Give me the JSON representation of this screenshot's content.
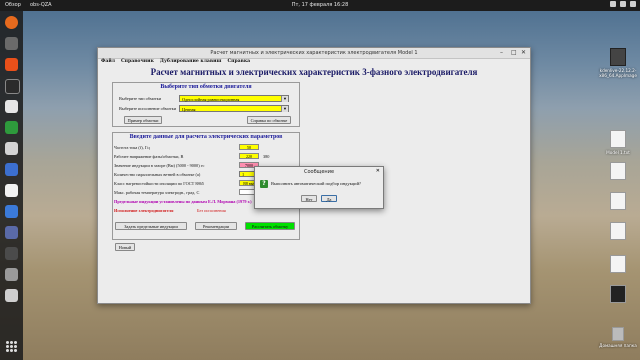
{
  "topbar": {
    "overview": "Обзор",
    "app": "obs-QZA",
    "clock": "Пт, 17 февраля 16:28"
  },
  "dock": {
    "icons": [
      "firefox-icon",
      "files-icon",
      "software-icon",
      "terminal-icon",
      "docs-icon",
      "spreadsheet-icon",
      "presentation-icon",
      "settings-icon",
      "text-editor-icon",
      "chrome-icon",
      "vmware-icon",
      "monitor-icon",
      "package-icon",
      "usb-icon"
    ]
  },
  "desktop": {
    "items": [
      {
        "label": "kdenlive-22.12.2-x86_64.AppImage",
        "icon": "package-icon"
      },
      {
        "label": "Model 1.txt",
        "icon": "text-file-icon"
      },
      {
        "label": "",
        "icon": "image-file-icon"
      },
      {
        "label": "",
        "icon": "image-file-icon"
      },
      {
        "label": "",
        "icon": "image-file-icon"
      },
      {
        "label": "",
        "icon": "image-file-icon"
      },
      {
        "label": "",
        "icon": "image-file-icon"
      },
      {
        "label": "Домашняя папка",
        "icon": "trash-icon"
      }
    ]
  },
  "window": {
    "title": "Расчет магнитных и электрических характеристик электродвигателя Model 1",
    "menu": [
      "Файл",
      "Справочник",
      "Дублирование клавиш",
      "Справка"
    ],
    "heading": "Расчет магнитных и электрических характеристик 3-фазного электродвигателя",
    "winding": {
      "title": "Выберите тип обмотки двигателя",
      "type_label": "Выберите тип обмотки",
      "type_value": "Однослойная равносекционная",
      "exec_label": "Выберите исполнение обмотки",
      "exec_value": "Цепная",
      "example_button": "Пример обмотки",
      "help_button": "Справка по обмотке"
    },
    "params": {
      "title": "Введите данные для расчета электрических параметров",
      "freq_label": "Частота тока (f), Гц",
      "freq_value": "50",
      "voltage_label": "Рабочее напряжение фазы/обмотки, В",
      "voltage_value": "220",
      "voltage_extra": "380",
      "induction_label": "Значение индукции в зазоре (Вм) (5000 - 9000) гс",
      "induction_value": "7000",
      "branches_label": "Количество параллельных ветвей в обмотке (а)",
      "branches_value": "1",
      "insulation_label": "Класс нагревостойкости изоляции по ГОСТ 8865",
      "insulation_value": "В8 выбрать",
      "temp_label": "Макс. рабочая температура электродв., град. С",
      "temp_value": "",
      "limit_text": "Предельные индукции установлены по данным Е.Л. Мормана (1979 г.)",
      "exec_text_label": "Исполнение электродвигателя",
      "exec_text_value": "Без исполнения",
      "set_induction_button": "Задать предельные индукции",
      "recommend_button": "Рекомендации",
      "calc_button": "Рассчитать обмотку"
    },
    "new_button": "Новый"
  },
  "dialog": {
    "title": "Сообщение",
    "message": "Выполнить автоматический подбор индукций?",
    "no_button": "Нет",
    "yes_button": "Да"
  }
}
